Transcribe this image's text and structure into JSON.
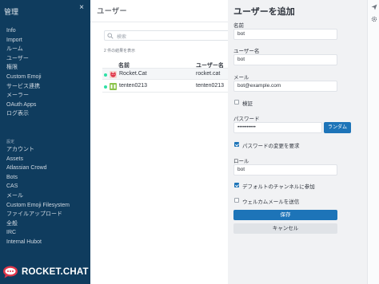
{
  "sidebar": {
    "title": "管理",
    "close_icon": "close-icon",
    "items": [
      "Info",
      "Import",
      "ルーム",
      "ユーザー",
      "権限",
      "Custom Emoji",
      "サービス連携",
      "メーラー",
      "OAuth Apps",
      "ログ表示"
    ],
    "section_label": "設定",
    "settings_items": [
      "アカウント",
      "Assets",
      "Atlassian Crowd",
      "Bots",
      "CAS",
      "メール",
      "Custom Emoji Filesystem",
      "ファイルアップロード",
      "全般",
      "IRC",
      "Internal Hubot"
    ],
    "logo_text": "ROCKET.CHAT"
  },
  "main": {
    "title": "ユーザー",
    "search": {
      "placeholder": "検索",
      "icon": "search-icon"
    },
    "result_count": "2 件の結果を表示",
    "columns": [
      "名前",
      "ユーザー名"
    ],
    "rows": [
      {
        "name": "Rocket.Cat",
        "username": "rocket.cat",
        "status": "online"
      },
      {
        "name": "tenten0213",
        "username": "tenten0213",
        "status": "online"
      }
    ]
  },
  "panel": {
    "title": "ユーザーを追加",
    "name_label": "名前",
    "name_value": "bot",
    "username_label": "ユーザー名",
    "username_value": "bot",
    "email_label": "メール",
    "email_value": "bot@example.com",
    "verified_label": "検証",
    "password_label": "パスワード",
    "password_value": "••••••••••",
    "random_button": "ランダム",
    "require_change_label": "パスワードの変更を要求",
    "role_label": "ロール",
    "role_value": "bot",
    "join_default_label": "デフォルトのチャンネルに参加",
    "send_welcome_label": "ウェルカムメールを送信",
    "save_button": "保存",
    "cancel_button": "キャンセル"
  },
  "rail": {
    "icons": [
      "send-icon",
      "settings-icon"
    ]
  },
  "colors": {
    "sidebar_bg": "#0f3c5e",
    "primary": "#1d74b8",
    "online": "#2de0a5"
  }
}
